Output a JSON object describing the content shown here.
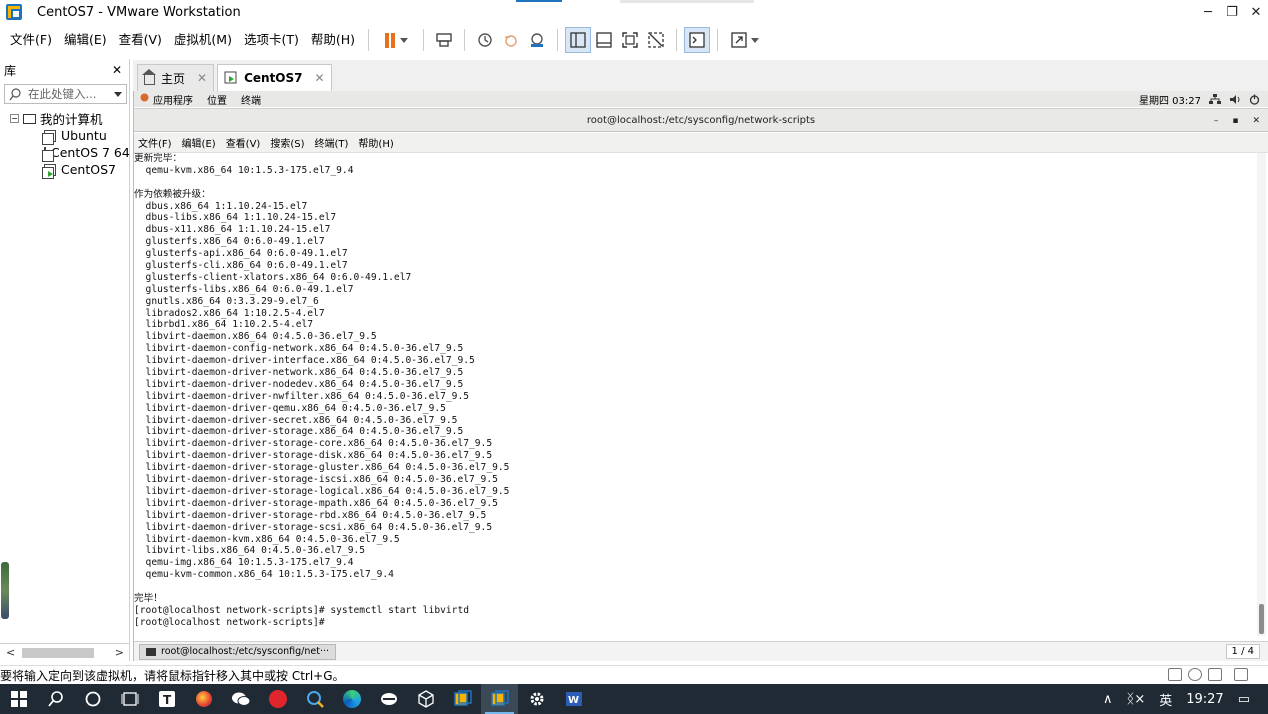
{
  "window": {
    "title": "CentOS7 - VMware Workstation",
    "minimize": "─",
    "maximize": "❐",
    "close": "✕"
  },
  "menu": [
    "文件(F)",
    "编辑(E)",
    "查看(V)",
    "虚拟机(M)",
    "选项卡(T)",
    "帮助(H)"
  ],
  "library": {
    "title": "库",
    "close": "✕",
    "search_placeholder": "在此处键入...",
    "root": "我的计算机",
    "vms": [
      "Ubuntu",
      "CentOS 7 64",
      "CentOS7"
    ],
    "scroll_left": "<",
    "scroll_right": ">"
  },
  "tabs": [
    {
      "label": "主页",
      "close": "✕"
    },
    {
      "label": "CentOS7",
      "close": "✕"
    }
  ],
  "guest": {
    "gnome_menu": [
      "应用程序",
      "位置",
      "终端"
    ],
    "clock": "星期四 03:27",
    "window_title": "root@localhost:/etc/sysconfig/network-scripts",
    "win_min": "–",
    "win_max": "▪",
    "win_close": "✕",
    "term_menu": [
      "文件(F)",
      "编辑(E)",
      "查看(V)",
      "搜索(S)",
      "终端(T)",
      "帮助(H)"
    ],
    "terminal_lines": [
      "更新完毕：",
      "  qemu-kvm.x86_64 10:1.5.3-175.el7_9.4",
      "",
      "作为依赖被升级：",
      "  dbus.x86_64 1:1.10.24-15.el7",
      "  dbus-libs.x86_64 1:1.10.24-15.el7",
      "  dbus-x11.x86_64 1:1.10.24-15.el7",
      "  glusterfs.x86_64 0:6.0-49.1.el7",
      "  glusterfs-api.x86_64 0:6.0-49.1.el7",
      "  glusterfs-cli.x86_64 0:6.0-49.1.el7",
      "  glusterfs-client-xlators.x86_64 0:6.0-49.1.el7",
      "  glusterfs-libs.x86_64 0:6.0-49.1.el7",
      "  gnutls.x86_64 0:3.3.29-9.el7_6",
      "  librados2.x86_64 1:10.2.5-4.el7",
      "  librbd1.x86_64 1:10.2.5-4.el7",
      "  libvirt-daemon.x86_64 0:4.5.0-36.el7_9.5",
      "  libvirt-daemon-config-network.x86_64 0:4.5.0-36.el7_9.5",
      "  libvirt-daemon-driver-interface.x86_64 0:4.5.0-36.el7_9.5",
      "  libvirt-daemon-driver-network.x86_64 0:4.5.0-36.el7_9.5",
      "  libvirt-daemon-driver-nodedev.x86_64 0:4.5.0-36.el7_9.5",
      "  libvirt-daemon-driver-nwfilter.x86_64 0:4.5.0-36.el7_9.5",
      "  libvirt-daemon-driver-qemu.x86_64 0:4.5.0-36.el7_9.5",
      "  libvirt-daemon-driver-secret.x86_64 0:4.5.0-36.el7_9.5",
      "  libvirt-daemon-driver-storage.x86_64 0:4.5.0-36.el7_9.5",
      "  libvirt-daemon-driver-storage-core.x86_64 0:4.5.0-36.el7_9.5",
      "  libvirt-daemon-driver-storage-disk.x86_64 0:4.5.0-36.el7_9.5",
      "  libvirt-daemon-driver-storage-gluster.x86_64 0:4.5.0-36.el7_9.5",
      "  libvirt-daemon-driver-storage-iscsi.x86_64 0:4.5.0-36.el7_9.5",
      "  libvirt-daemon-driver-storage-logical.x86_64 0:4.5.0-36.el7_9.5",
      "  libvirt-daemon-driver-storage-mpath.x86_64 0:4.5.0-36.el7_9.5",
      "  libvirt-daemon-driver-storage-rbd.x86_64 0:4.5.0-36.el7_9.5",
      "  libvirt-daemon-driver-storage-scsi.x86_64 0:4.5.0-36.el7_9.5",
      "  libvirt-daemon-kvm.x86_64 0:4.5.0-36.el7_9.5",
      "  libvirt-libs.x86_64 0:4.5.0-36.el7_9.5",
      "  qemu-img.x86_64 10:1.5.3-175.el7_9.4",
      "  qemu-kvm-common.x86_64 10:1.5.3-175.el7_9.4",
      "",
      "完毕！",
      "[root@localhost network-scripts]# systemctl start libvirtd",
      "[root@localhost network-scripts]# "
    ],
    "taskbar_item": "root@localhost:/etc/sysconfig/net···",
    "pager": "1 / 4"
  },
  "status_text": "要将输入定向到该虚拟机，请将鼠标指针移入其中或按 Ctrl+G。",
  "tray": {
    "chevron": "∧",
    "volume": "ᛝ×",
    "ime": "英",
    "time": "19:27",
    "notification": "▭"
  },
  "colors": {
    "taskbar": "#1f2a35",
    "accent": "#1e73be",
    "pause": "#e8701a"
  }
}
